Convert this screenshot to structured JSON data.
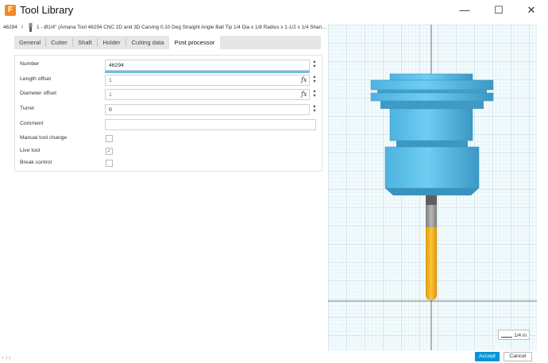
{
  "window": {
    "title": "Tool Library",
    "app_icon_letter": "F",
    "minimize_glyph": "—",
    "maximize_glyph": "☐",
    "close_glyph": "✕"
  },
  "breadcrumb": {
    "tool_id": "46294",
    "separator": "/",
    "description": "1 - Ø1/4\" (Amana Tool 46294 CNC 2D and 3D Carving 0.10 Deg Straight Angle Ball Tip 1/4 Dia x 1/8 Radius x 1-1/2 x 1/4 Shank x 3 In..."
  },
  "tabs": [
    {
      "label": "General"
    },
    {
      "label": "Cutter"
    },
    {
      "label": "Shaft"
    },
    {
      "label": "Holder"
    },
    {
      "label": "Cutting data"
    },
    {
      "label": "Post processor",
      "selected": true
    }
  ],
  "form": {
    "number": {
      "label": "Number",
      "value": "46294"
    },
    "length_offset": {
      "label": "Length offset",
      "value": "1"
    },
    "diameter_offset": {
      "label": "Diameter offset",
      "value": "1"
    },
    "turret": {
      "label": "Turret",
      "value": "0"
    },
    "comment": {
      "label": "Comment",
      "value": ""
    },
    "manual_tool_change": {
      "label": "Manual tool change",
      "checked": false
    },
    "live_tool": {
      "label": "Live tool",
      "checked": true
    },
    "break_control": {
      "label": "Break control",
      "checked": false
    },
    "fx_symbol": "fx",
    "spin_up": "▲",
    "spin_down": "▼",
    "check_mark": "✓"
  },
  "viewport": {
    "scale_label": "1/4 in",
    "colors": {
      "grid_minor": "#c8e6ee",
      "grid_major": "#9fcfdd",
      "holder": "#62c4ec",
      "holder_dark": "#3f97bf",
      "shank": "#9e9e9e",
      "flute": "#f6b21a"
    }
  },
  "footer": {
    "accept_label": "Accept",
    "cancel_label": "Cancel",
    "version_hint": "v. 1.1"
  }
}
